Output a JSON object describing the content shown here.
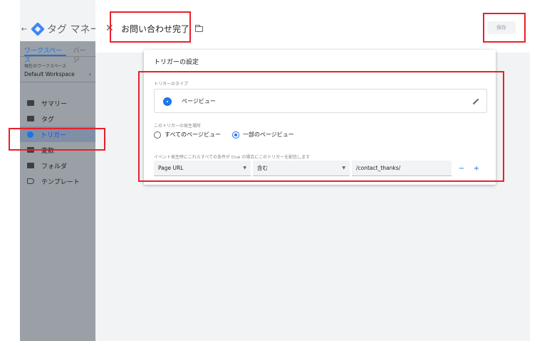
{
  "app": {
    "product_title": "タグ マネー",
    "tabs": [
      "ワークスペース",
      "バージ"
    ],
    "workspace_label": "現在のワークスペース",
    "workspace_name": "Default Workspace",
    "workspace_chevron": "›",
    "nav": [
      {
        "label": "サマリー",
        "icon": "briefcase-icon"
      },
      {
        "label": "タグ",
        "icon": "tag-icon"
      },
      {
        "label": "トリガー",
        "icon": "trigger-icon",
        "active": true
      },
      {
        "label": "変数",
        "icon": "variables-icon"
      },
      {
        "label": "フォルダ",
        "icon": "folder-icon"
      },
      {
        "label": "テンプレート",
        "icon": "template-icon"
      }
    ]
  },
  "panel": {
    "close_glyph": "✕",
    "trigger_name": "お問い合わせ完了",
    "save_label": "保存"
  },
  "card": {
    "title": "トリガーの設定",
    "type_label": "トリガーのタイプ",
    "type_value": "ページビュー",
    "fire_label": "このトリガーの発生場所",
    "radio_all": "すべてのページビュー",
    "radio_some": "一部のページビュー",
    "condition_label": "イベント発生時にこれらすべての条件が true の場合にこのトリガーを配信します",
    "filter": {
      "variable": "Page URL",
      "operator": "含む",
      "value": "/contact_thanks/"
    },
    "minus_glyph": "−",
    "plus_glyph": "+"
  },
  "colors": {
    "accent": "#1a73e8",
    "highlight": "#e8202a"
  }
}
